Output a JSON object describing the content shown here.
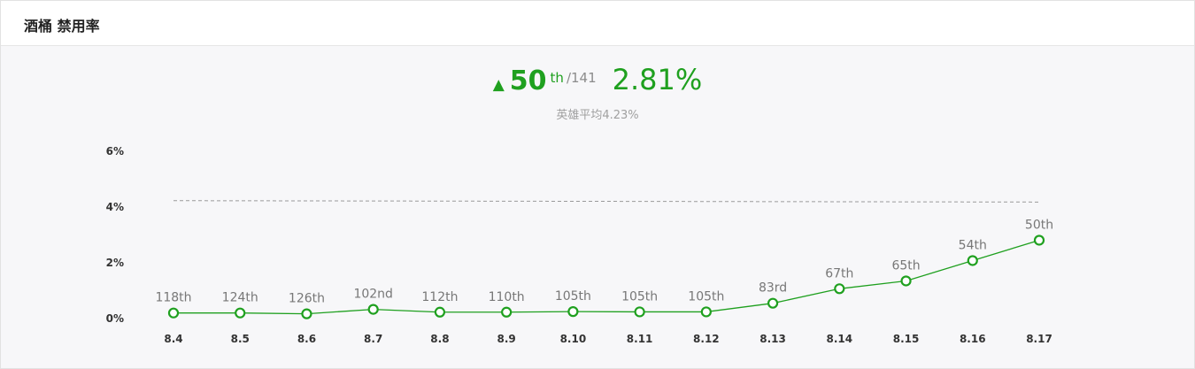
{
  "header": {
    "title": "酒桶 禁用率"
  },
  "summary": {
    "arrow": "▲",
    "rank": "50",
    "rank_suffix": "th",
    "rank_total": "/141",
    "rate": "2.81%",
    "average": "英雄平均4.23%"
  },
  "colors": {
    "accent": "#1fa01f",
    "average_line": "#9a9a9a",
    "rank_label": "#777777"
  },
  "chart_data": {
    "type": "line",
    "categories": [
      "8.4",
      "8.5",
      "8.6",
      "8.7",
      "8.8",
      "8.9",
      "8.10",
      "8.11",
      "8.12",
      "8.13",
      "8.14",
      "8.15",
      "8.16",
      "8.17"
    ],
    "y_ticks": [
      "0%",
      "2%",
      "4%",
      "6%"
    ],
    "ylim": [
      0,
      6
    ],
    "grid": false,
    "series": [
      {
        "values": [
          0.2,
          0.2,
          0.17,
          0.33,
          0.23,
          0.23,
          0.25,
          0.24,
          0.24,
          0.55,
          1.07,
          1.35,
          2.08,
          2.81
        ],
        "point_labels": [
          "118th",
          "124th",
          "126th",
          "102nd",
          "112th",
          "110th",
          "105th",
          "105th",
          "105th",
          "83rd",
          "67th",
          "65th",
          "54th",
          "50th"
        ]
      }
    ],
    "reference_line": {
      "start": 4.23,
      "end": 4.18
    }
  }
}
